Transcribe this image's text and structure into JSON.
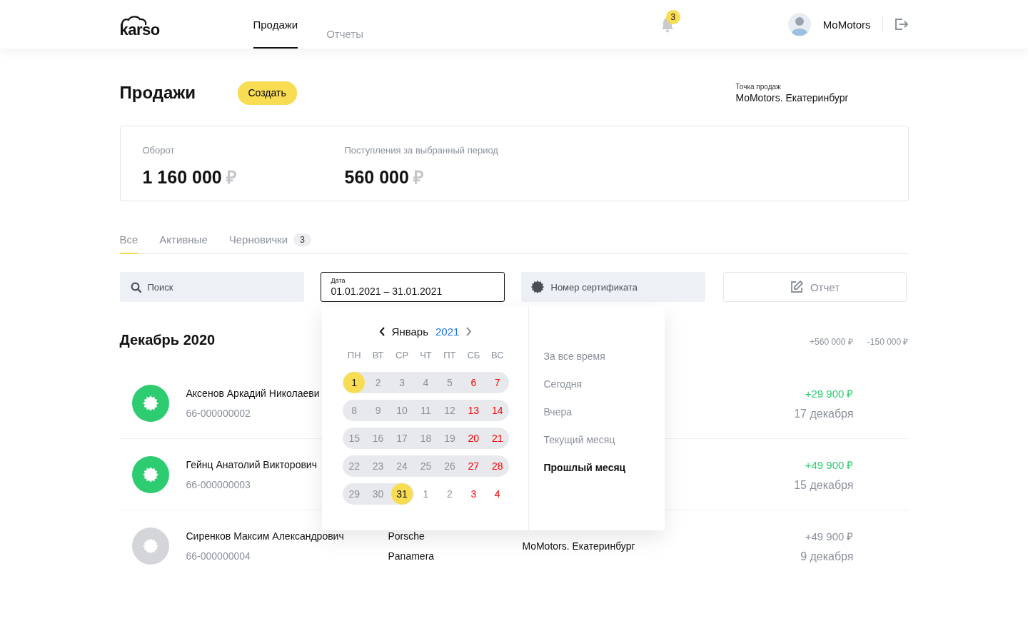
{
  "header": {
    "logo": "karso",
    "nav": [
      {
        "label": "Продажи",
        "selected": true
      },
      {
        "label": "Отчеты",
        "selected": false
      }
    ],
    "notifications": "3",
    "user": "MoMotors"
  },
  "page": {
    "title": "Продажи",
    "create_button": "Создать",
    "point_label": "Точка продаж",
    "point_value": "MoMotors. Екатеринбург"
  },
  "stats": [
    {
      "label": "Оборот",
      "value": "1 160 000",
      "currency": "₽"
    },
    {
      "label": "Поступления за выбранный период",
      "value": "560 000",
      "currency": "₽"
    }
  ],
  "tabs": [
    {
      "label": "Все",
      "selected": true
    },
    {
      "label": "Активные",
      "selected": false
    },
    {
      "label": "Черновички",
      "selected": false,
      "badge": "3"
    }
  ],
  "filters": {
    "search": {
      "placeholder": "Поиск"
    },
    "date": {
      "label": "Дата",
      "value": "01.01.2021 – 31.01.2021"
    },
    "certificate": {
      "placeholder": "Номер сертификата"
    },
    "report_button": "Отчет"
  },
  "section": {
    "title": "Декабрь 2020",
    "income": "+560 000 ₽",
    "expense": "-150 000 ₽"
  },
  "rows": [
    {
      "kind": "active",
      "name": "Аксенов Аркадий Николаеви",
      "number": "66-000000002",
      "amount": "+29 900 ₽",
      "date": "17 декабря"
    },
    {
      "kind": "active",
      "name": "Гейнц Анатолий Викторович",
      "number": "66-000000003",
      "amount": "+49 900 ₽",
      "date": "15 декабря"
    },
    {
      "kind": "draft",
      "name": "Сиренков Максим Александрович",
      "number": "66-000000004",
      "car": [
        "Porsche",
        "Panamera"
      ],
      "point": "MoMotors. Екатеринбург",
      "amount": "+49 900 ₽",
      "date": "9 декабря"
    }
  ],
  "datepicker": {
    "month": "Январь",
    "year": "2021",
    "weekdays": [
      "ПН",
      "ВТ",
      "СР",
      "ЧТ",
      "ПТ",
      "СБ",
      "ВС"
    ],
    "weeks": [
      [
        {
          "label": "1",
          "weekend": false,
          "in_range": true,
          "selected": true
        },
        {
          "label": "2",
          "weekend": false,
          "in_range": true,
          "selected": false
        },
        {
          "label": "3",
          "weekend": false,
          "in_range": true,
          "selected": false
        },
        {
          "label": "4",
          "weekend": false,
          "in_range": true,
          "selected": false
        },
        {
          "label": "5",
          "weekend": false,
          "in_range": true,
          "selected": false
        },
        {
          "label": "6",
          "weekend": true,
          "in_range": true,
          "selected": false
        },
        {
          "label": "7",
          "weekend": true,
          "in_range": true,
          "selected": false
        }
      ],
      [
        {
          "label": "8",
          "weekend": false,
          "in_range": true,
          "selected": false
        },
        {
          "label": "9",
          "weekend": false,
          "in_range": true,
          "selected": false
        },
        {
          "label": "10",
          "weekend": false,
          "in_range": true,
          "selected": false
        },
        {
          "label": "11",
          "weekend": false,
          "in_range": true,
          "selected": false
        },
        {
          "label": "12",
          "weekend": false,
          "in_range": true,
          "selected": false
        },
        {
          "label": "13",
          "weekend": true,
          "in_range": true,
          "selected": false
        },
        {
          "label": "14",
          "weekend": true,
          "in_range": true,
          "selected": false
        }
      ],
      [
        {
          "label": "15",
          "weekend": false,
          "in_range": true,
          "selected": false
        },
        {
          "label": "16",
          "weekend": false,
          "in_range": true,
          "selected": false
        },
        {
          "label": "17",
          "weekend": false,
          "in_range": true,
          "selected": false
        },
        {
          "label": "18",
          "weekend": false,
          "in_range": true,
          "selected": false
        },
        {
          "label": "19",
          "weekend": false,
          "in_range": true,
          "selected": false
        },
        {
          "label": "20",
          "weekend": true,
          "in_range": true,
          "selected": false
        },
        {
          "label": "21",
          "weekend": true,
          "in_range": true,
          "selected": false
        }
      ],
      [
        {
          "label": "22",
          "weekend": false,
          "in_range": true,
          "selected": false
        },
        {
          "label": "23",
          "weekend": false,
          "in_range": true,
          "selected": false
        },
        {
          "label": "24",
          "weekend": false,
          "in_range": true,
          "selected": false
        },
        {
          "label": "25",
          "weekend": false,
          "in_range": true,
          "selected": false
        },
        {
          "label": "26",
          "weekend": false,
          "in_range": true,
          "selected": false
        },
        {
          "label": "27",
          "weekend": true,
          "in_range": true,
          "selected": false
        },
        {
          "label": "28",
          "weekend": true,
          "in_range": true,
          "selected": false
        }
      ],
      [
        {
          "label": "29",
          "weekend": false,
          "in_range": true,
          "selected": false
        },
        {
          "label": "30",
          "weekend": false,
          "in_range": true,
          "selected": false
        },
        {
          "label": "31",
          "weekend": false,
          "in_range": true,
          "selected": true
        },
        {
          "label": "1",
          "weekend": false,
          "in_range": false,
          "selected": false
        },
        {
          "label": "2",
          "weekend": false,
          "in_range": false,
          "selected": false
        },
        {
          "label": "3",
          "weekend": true,
          "in_range": false,
          "selected": false
        },
        {
          "label": "4",
          "weekend": true,
          "in_range": false,
          "selected": false
        }
      ]
    ],
    "presets": [
      {
        "label": "За все время",
        "selected": false
      },
      {
        "label": "Сегодня",
        "selected": false
      },
      {
        "label": "Вчера",
        "selected": false
      },
      {
        "label": "Текущий месяц",
        "selected": false
      },
      {
        "label": "Прошлый месяц",
        "selected": true
      }
    ]
  }
}
